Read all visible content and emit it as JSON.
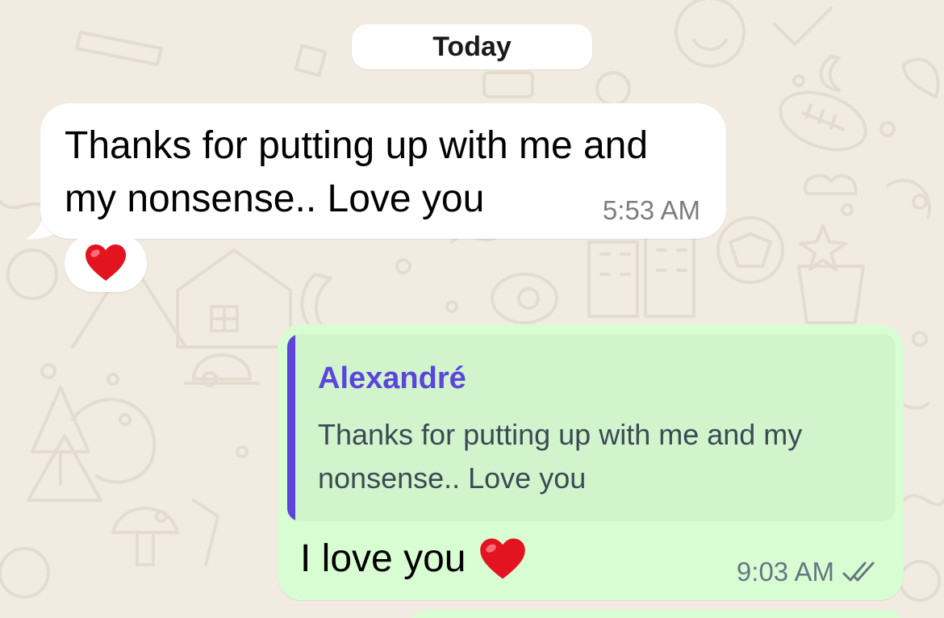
{
  "chat": {
    "date_separator": "Today",
    "incoming_message": {
      "text": "Thanks for putting up with me and my nonsense.. Love you",
      "time": "5:53 AM",
      "reaction": "heart-emoji"
    },
    "outgoing_message": {
      "reply_to": {
        "author": "Alexandré",
        "text": "Thanks for putting up with me and my nonsense.. Love you"
      },
      "text": "I love you",
      "emoji": "heart-emoji",
      "time": "9:03 AM",
      "status": "read-double-check-icon"
    }
  },
  "colors": {
    "wallpaper": "#f1ebe1",
    "incoming_bubble": "#ffffff",
    "outgoing_bubble": "#d9fdd3",
    "quote_background": "#d1f4cc",
    "quote_accent": "#5b45dd",
    "timestamp": "#7d7d7d",
    "heart": "#e3141f"
  }
}
